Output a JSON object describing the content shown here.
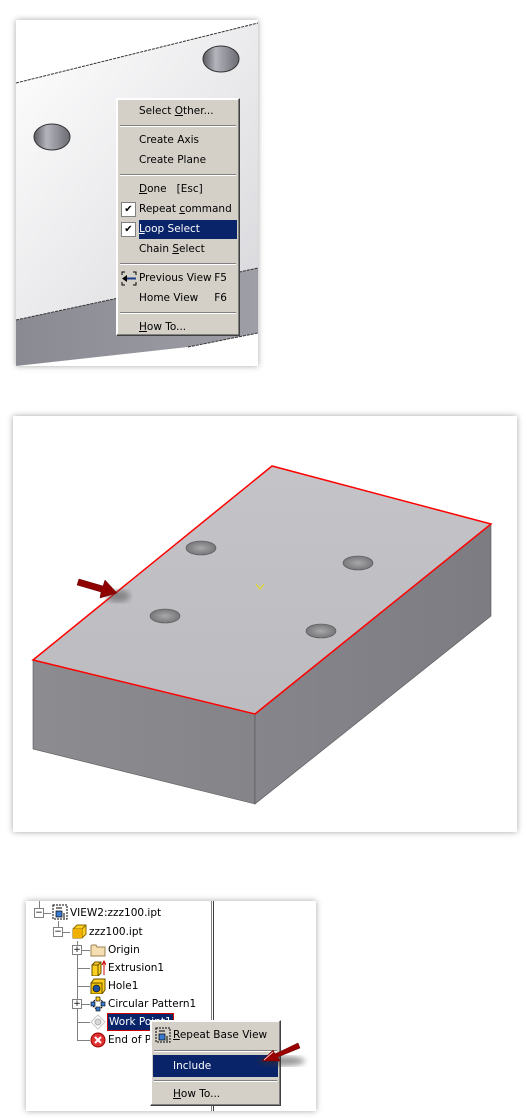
{
  "panel1": {
    "context_menu": {
      "items": [
        {
          "label_pre": "Select ",
          "label_u": "O",
          "label_post": "ther...",
          "shortcut": "",
          "checked": false,
          "highlighted": false
        },
        {
          "label_pre": "Create Axis",
          "label_u": "",
          "label_post": "",
          "shortcut": "",
          "checked": false,
          "highlighted": false
        },
        {
          "label_pre": "Create Plane",
          "label_u": "",
          "label_post": "",
          "shortcut": "",
          "checked": false,
          "highlighted": false
        },
        {
          "label_pre": "",
          "label_u": "D",
          "label_post": "one   [Esc]",
          "shortcut": "",
          "checked": false,
          "highlighted": false
        },
        {
          "label_pre": "Repeat ",
          "label_u": "c",
          "label_post": "ommand",
          "shortcut": "",
          "checked": true,
          "highlighted": false
        },
        {
          "label_pre": "",
          "label_u": "L",
          "label_post": "oop Select",
          "shortcut": "",
          "checked": true,
          "highlighted": true
        },
        {
          "label_pre": "Chain ",
          "label_u": "S",
          "label_post": "elect",
          "shortcut": "",
          "checked": false,
          "highlighted": false
        },
        {
          "label_pre": "Previous View",
          "label_u": "",
          "label_post": "",
          "shortcut": "F5",
          "checked": false,
          "highlighted": false,
          "icon": "previous-view-icon"
        },
        {
          "label_pre": "Home View",
          "label_u": "",
          "label_post": "",
          "shortcut": "F6",
          "checked": false,
          "highlighted": false
        },
        {
          "label_pre": "",
          "label_u": "H",
          "label_post": "ow To...",
          "shortcut": "",
          "checked": false,
          "highlighted": false
        }
      ],
      "check_glyph": "✔"
    }
  },
  "panel2": {
    "selection_color": "#ff0000",
    "arrow_color": "#9a0000",
    "center_marker": "⌄"
  },
  "panel3": {
    "tree": [
      {
        "label": "VIEW2:zzz100.ipt",
        "icon": "drawing-view-icon",
        "expander": "−"
      },
      {
        "label": "zzz100.ipt",
        "icon": "part-icon",
        "expander": "−"
      },
      {
        "label": "Origin",
        "icon": "folder-icon",
        "expander": "+"
      },
      {
        "label": "Extrusion1",
        "icon": "extrusion-icon",
        "expander": ""
      },
      {
        "label": "Hole1",
        "icon": "hole-icon",
        "expander": ""
      },
      {
        "label": "Circular Pattern1",
        "icon": "circular-pattern-icon",
        "expander": "+"
      },
      {
        "label": "Work Point1",
        "icon": "work-point-icon",
        "expander": "",
        "selected": true
      },
      {
        "label": "End of Part",
        "icon": "end-of-part-icon",
        "expander": ""
      }
    ],
    "context_menu": {
      "items": [
        {
          "label_pre": "",
          "label_u": "R",
          "label_post": "epeat Base View",
          "highlighted": false
        },
        {
          "label_pre": "Include",
          "label_u": "",
          "label_post": "",
          "highlighted": true
        },
        {
          "label_pre": "",
          "label_u": "H",
          "label_post": "ow To...",
          "highlighted": false
        }
      ]
    }
  }
}
